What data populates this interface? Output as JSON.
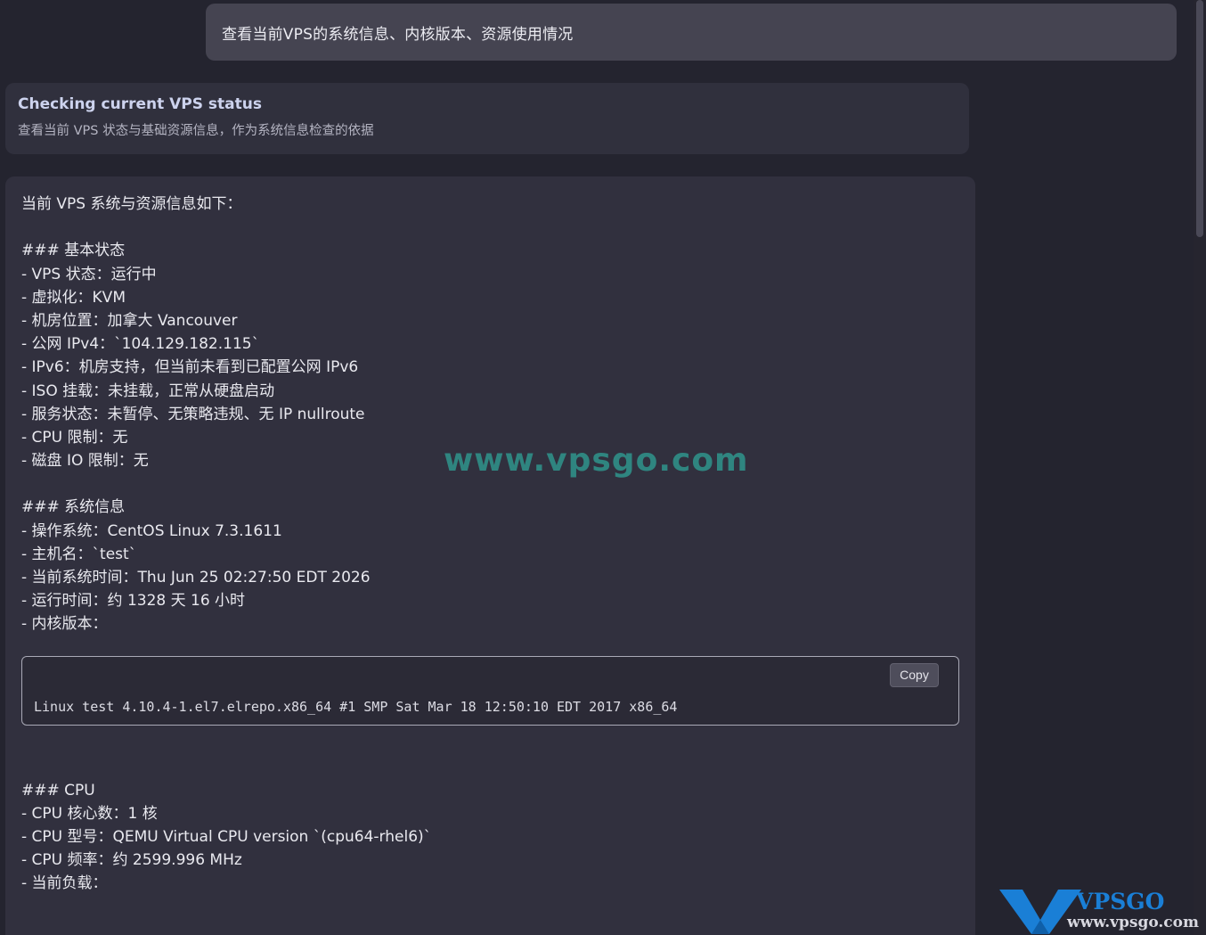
{
  "user_message": "查看当前VPS的系统信息、内核版本、资源使用情况",
  "status_card": {
    "title": "Checking current VPS status",
    "subtitle": "查看当前 VPS 状态与基础资源信息，作为系统信息检查的依据"
  },
  "answer": {
    "intro": "当前 VPS 系统与资源信息如下：",
    "basic_heading": "### 基本状态",
    "basic_items": [
      "- VPS 状态：运行中",
      "- 虚拟化：KVM",
      "- 机房位置：加拿大 Vancouver",
      "- 公网 IPv4：`104.129.182.115`",
      "- IPv6：机房支持，但当前未看到已配置公网 IPv6",
      "- ISO 挂载：未挂载，正常从硬盘启动",
      "- 服务状态：未暂停、无策略违规、无 IP nullroute",
      "- CPU 限制：无",
      "- 磁盘 IO 限制：无"
    ],
    "sys_heading": "### 系统信息",
    "sys_items": [
      "- 操作系统：CentOS Linux 7.3.1611",
      "- 主机名：`test`",
      "- 当前系统时间：Thu Jun 25 02:27:50 EDT 2026",
      "- 运行时间：约 1328 天 16 小时",
      "- 内核版本："
    ],
    "code": {
      "copy_label": "Copy",
      "text": "Linux test 4.10.4-1.el7.elrepo.x86_64 #1 SMP Sat Mar 18 12:50:10 EDT 2017 x86_64"
    },
    "cpu_heading": "### CPU",
    "cpu_items": [
      "- CPU 核心数：1 核",
      "- CPU 型号：QEMU Virtual CPU version `(cpu64-rhel6)`",
      "- CPU 频率：约 2599.996 MHz",
      "- 当前负载："
    ]
  },
  "watermark": "www.vpsgo.com",
  "logo": {
    "brand": "VPSGO",
    "sub": "www.vpsgo.com"
  },
  "colors": {
    "background": "#24242f",
    "card": "#31303e",
    "user_bubble": "#454451",
    "watermark": "#2f8a84",
    "logo_blue": "#1a7fd6"
  }
}
